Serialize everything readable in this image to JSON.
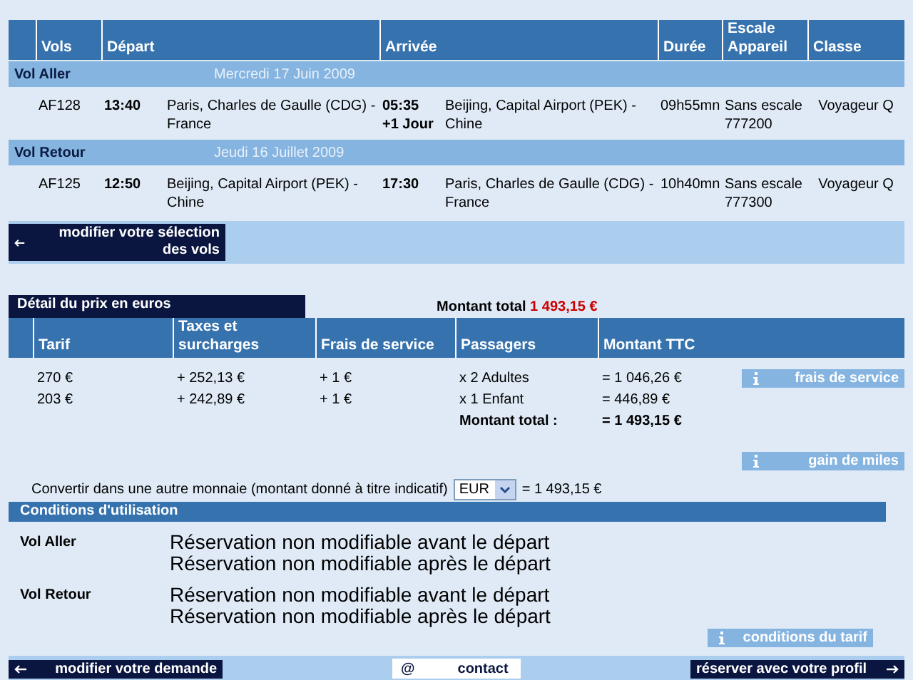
{
  "flights": {
    "columns": [
      "Vols",
      "Départ",
      "Arrivée",
      "Durée",
      "Escale Appareil",
      "Classe"
    ],
    "legs": [
      {
        "label": "Vol Aller",
        "date": "Mercredi 17 Juin 2009",
        "flight": "AF128",
        "departure_time": "13:40",
        "departure_place": "Paris, Charles de Gaulle (CDG) - France",
        "arrival_time": "05:35",
        "arrival_day": "+1 Jour",
        "arrival_place": "Beijing, Capital Airport (PEK) - Chine",
        "duration": "09h55mn",
        "stops": "Sans escale",
        "aircraft": "777200",
        "class": "Voyageur Q"
      },
      {
        "label": "Vol Retour",
        "date": "Jeudi 16 Juillet 2009",
        "flight": "AF125",
        "departure_time": "12:50",
        "departure_place": "Beijing, Capital Airport (PEK) - Chine",
        "arrival_time": "17:30",
        "arrival_place": "Paris, Charles de Gaulle (CDG) - France",
        "duration": "10h40mn",
        "stops": "Sans escale",
        "aircraft": "777300",
        "class": "Voyageur Q"
      }
    ]
  },
  "modify_selection_button": "modifier votre sélection des vols",
  "price": {
    "title": "Détail du prix en euros",
    "total_label": "Montant total",
    "total_value": "1 493,15 €",
    "columns": [
      "Tarif",
      "Taxes et surcharges",
      "Frais de service",
      "Passagers",
      "Montant TTC"
    ],
    "rows": [
      {
        "fare": "270 €",
        "taxes": "+ 252,13 €",
        "fee": "+ 1 €",
        "passengers": "x 2 Adultes",
        "amount": "= 1 046,26 €"
      },
      {
        "fare": "203 €",
        "taxes": "+ 242,89 €",
        "fee": "+ 1 €",
        "passengers": "x 1 Enfant",
        "amount": "= 446,89 €"
      }
    ],
    "sum_label": "Montant total :",
    "sum_value": "= 1 493,15 €",
    "fees_button": "frais de service",
    "miles_button": "gain de miles"
  },
  "converter": {
    "label": "Convertir dans une autre monnaie (montant donné à titre indicatif)",
    "currency": "EUR",
    "result": "= 1 493,15 €"
  },
  "conditions": {
    "title": "Conditions d'utilisation",
    "legs": [
      {
        "label": "Vol Aller",
        "rules": [
          "Réservation non modifiable avant le départ",
          "Réservation non modifiable après le départ"
        ]
      },
      {
        "label": "Vol Retour",
        "rules": [
          "Réservation non modifiable avant le départ",
          "Réservation non modifiable après le départ"
        ]
      }
    ],
    "tariff_button": "conditions du tarif"
  },
  "footer": {
    "back_button": "modifier votre demande",
    "contact_icon": "@",
    "contact_button": "contact",
    "book_button": "réserver avec votre profil"
  }
}
